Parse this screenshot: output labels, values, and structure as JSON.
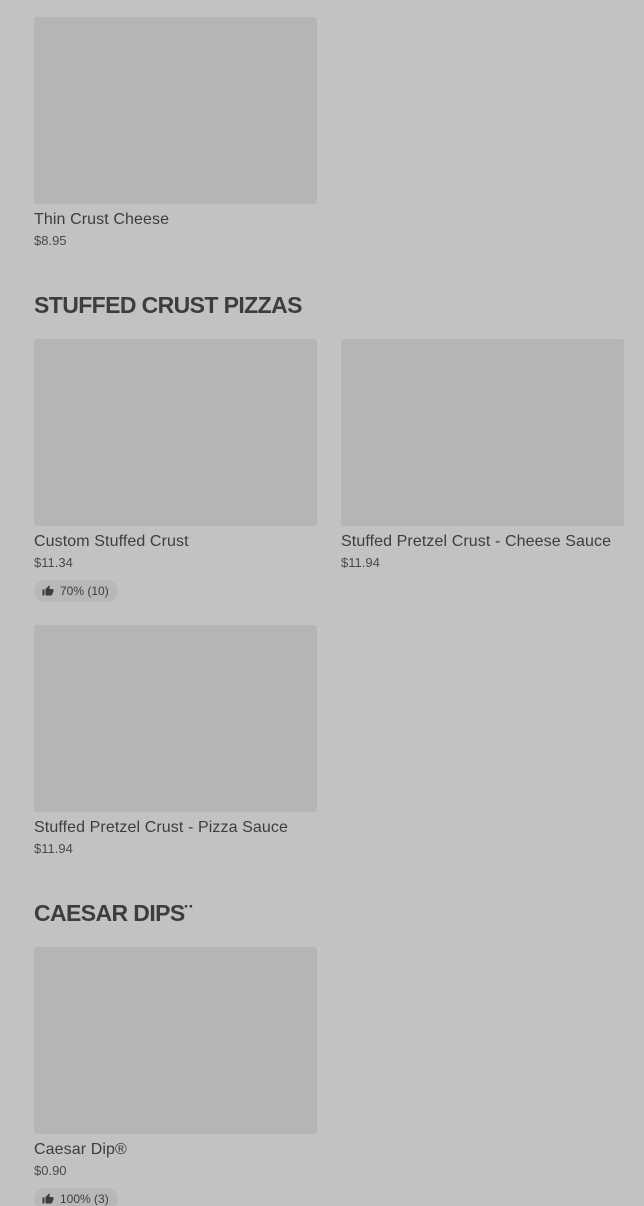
{
  "sections": [
    {
      "items": [
        {
          "name": "Thin Crust Cheese",
          "price": "$8.95"
        }
      ]
    },
    {
      "title": "STUFFED CRUST PIZZAS",
      "items": [
        {
          "name": "Custom Stuffed Crust",
          "price": "$11.34",
          "rating": "70% (10)",
          "rating_icon": "thumbs-up-icon"
        },
        {
          "name": "Stuffed Pretzel Crust - Cheese Sauce",
          "price": "$11.94"
        },
        {
          "name": "Stuffed Pretzel Crust - Pizza Sauce",
          "price": "$11.94"
        }
      ]
    },
    {
      "title": "CAESAR DIPS¨",
      "items": [
        {
          "name": "Caesar Dip®",
          "price": "$0.90",
          "rating": "100% (3)",
          "rating_icon": "thumbs-up-icon"
        }
      ]
    }
  ],
  "colors": {
    "background": "#c2c2c2",
    "image_placeholder": "#b5b5b5",
    "text": "#3d3d3d"
  }
}
